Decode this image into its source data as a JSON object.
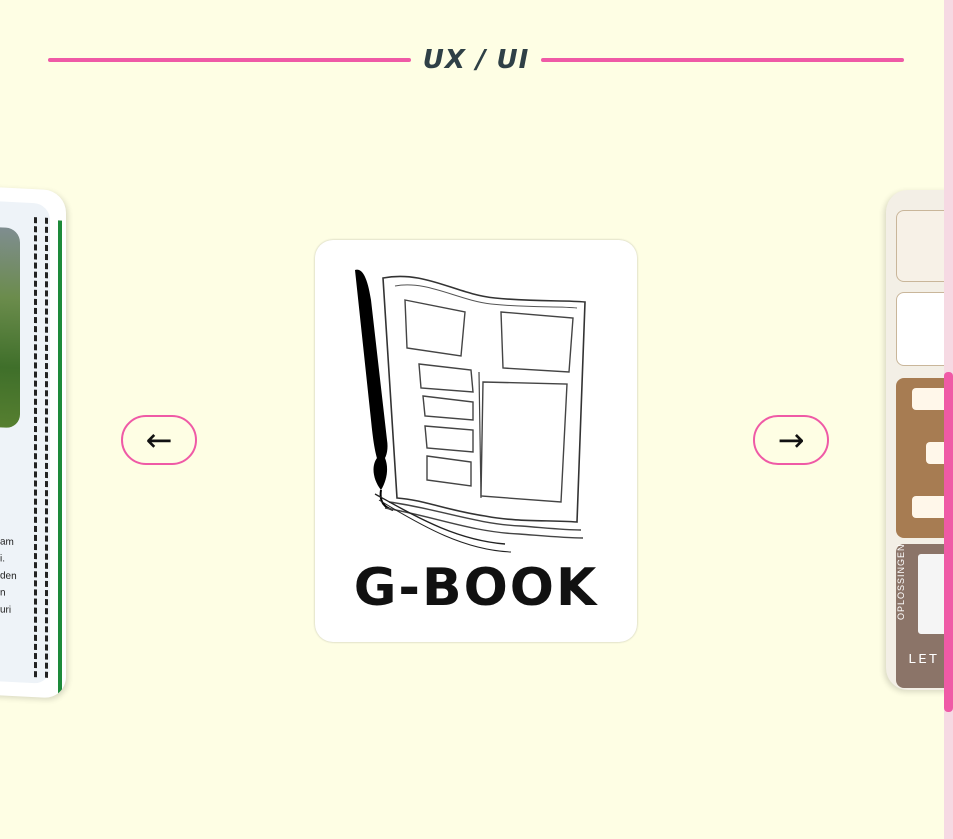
{
  "header": {
    "title": "UX / UI"
  },
  "carousel": {
    "prev_label": "←",
    "next_label": "→",
    "current": {
      "logo_text": "G-BOOK"
    },
    "left_preview": {
      "lines": [
        "am",
        "i.",
        "den",
        "n",
        "uri"
      ]
    },
    "right_preview": {
      "vertical_label": "OPLOSSINGEN",
      "bottom_label": "LET"
    }
  },
  "colors": {
    "accent": "#ef5aa6",
    "background": "#fefee4",
    "title": "#2f4046"
  }
}
